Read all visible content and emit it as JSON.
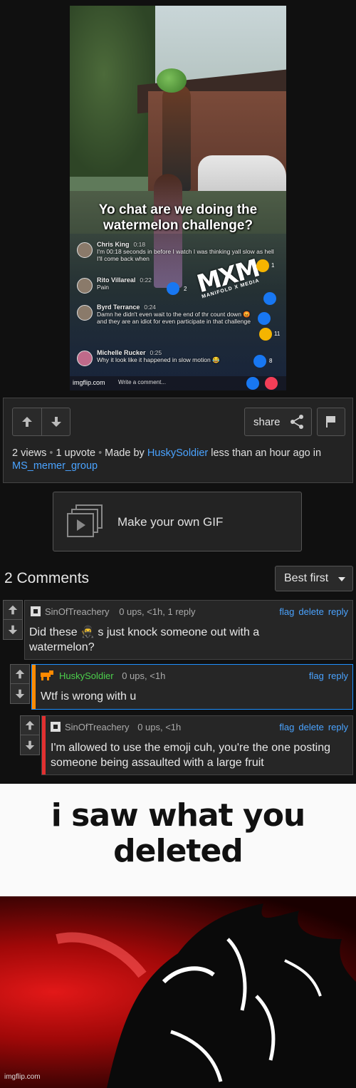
{
  "video": {
    "caption": "Yo chat are we doing the watermelon challenge?",
    "comments": [
      {
        "name": "Chris King",
        "time": "0:18",
        "text": "I'm 00:18 seconds in before I watch I was thinking yall slow as hell I'll come back when"
      },
      {
        "name": "Rito Villareal",
        "time": "0:22",
        "text": "Pain"
      },
      {
        "name": "Byrd Terrance",
        "time": "0:24",
        "text": "Damn he didn't even wait to the end of thr count down 😡 and they are an idiot for even participate in that challenge"
      },
      {
        "name": "Michelle Rucker",
        "time": "0:25",
        "text": "Why it look like it happened in slow motion 😂"
      }
    ],
    "logo": "MXM",
    "logo_sub": "MANIFOLD X MEDIA",
    "write_comment": "Write a comment...",
    "watermark": "imgflip.com",
    "reaction_counts": [
      "1",
      "2",
      "11",
      "8"
    ]
  },
  "post": {
    "share_label": "share",
    "views": "2 views",
    "upvotes": "1 upvote",
    "made_by_prefix": "Made by",
    "author": "HuskySoldier",
    "time_text": "less than an hour ago in",
    "stream": "MS_memer_group"
  },
  "make_gif": {
    "label": "Make your own GIF"
  },
  "comments": {
    "count_label": "2 Comments",
    "sort_label": "Best first",
    "items": [
      {
        "user": "SinOfTreachery",
        "meta": "0 ups, <1h, 1 reply",
        "actions": [
          "flag",
          "delete",
          "reply"
        ],
        "text": "Did these 🥷 s just knock someone out with a watermelon?"
      },
      {
        "user": "HuskySoldier",
        "meta": "0 ups, <1h",
        "actions": [
          "flag",
          "reply"
        ],
        "text": "Wtf is wrong with u"
      },
      {
        "user": "SinOfTreachery",
        "meta": "0 ups, <1h",
        "actions": [
          "flag",
          "delete",
          "reply"
        ],
        "text": "I'm allowed to use the emoji cuh, you're the one posting someone being assaulted with a large fruit"
      }
    ]
  },
  "meme": {
    "text_line1": "i saw what you",
    "text_line2": "deleted",
    "watermark": "imgflip.com"
  },
  "colors": {
    "link": "#4aa3ff",
    "bar_orange": "#ff8a00",
    "bar_red": "#e23030",
    "husky_name": "#4ccf4c"
  }
}
